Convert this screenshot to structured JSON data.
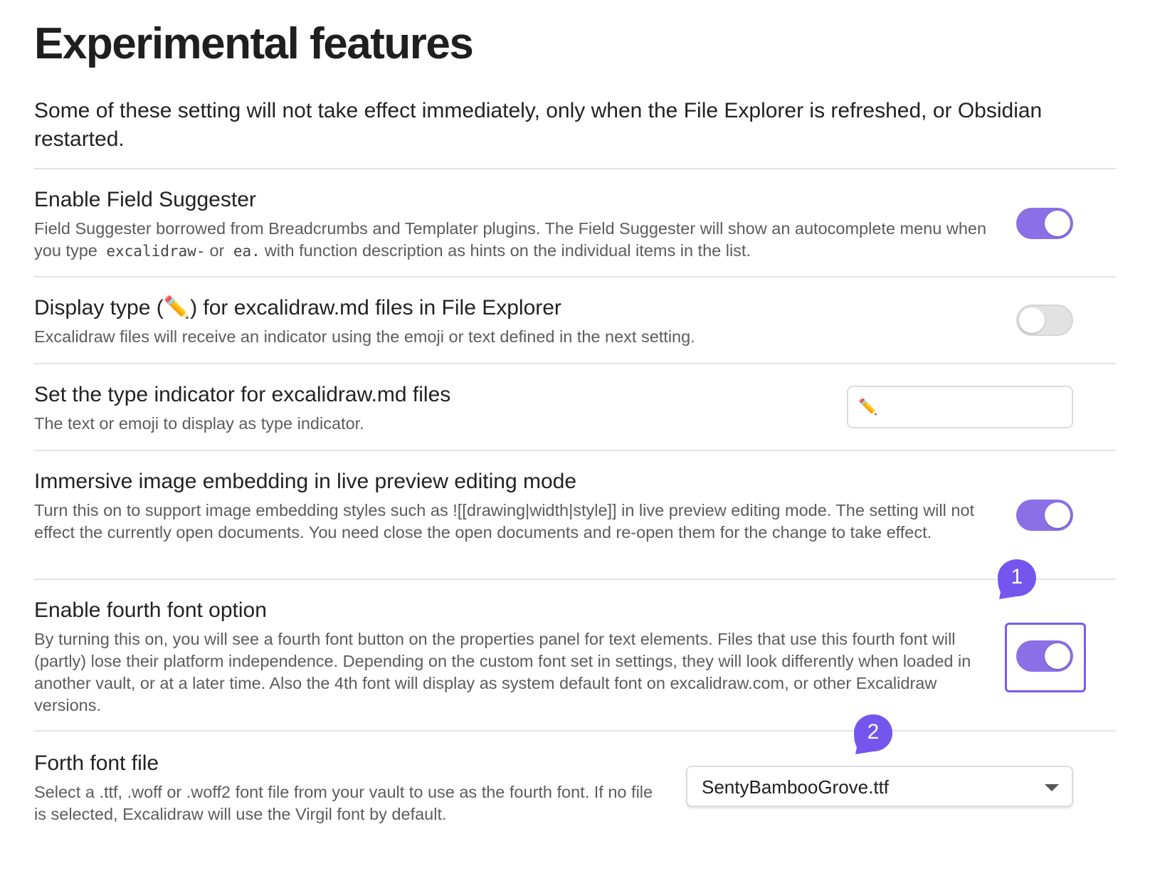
{
  "page": {
    "title": "Experimental features",
    "intro": "Some of these setting will not take effect immediately, only when the File Explorer is refreshed, or Obsidian restarted."
  },
  "settings": [
    {
      "name": "Enable Field Suggester",
      "desc_before": "Field Suggester borrowed from Breadcrumbs and Templater plugins. The Field Suggester will show an autocomplete menu when you type",
      "code1": "excalidraw-",
      "desc_mid": "or",
      "code2": "ea.",
      "desc_after": "with function description as hints on the individual items in the list.",
      "control": "toggle",
      "enabled": true
    },
    {
      "name": "Display type (✏️) for excalidraw.md files in File Explorer",
      "desc": "Excalidraw files will receive an indicator using the emoji or text defined in the next setting.",
      "control": "toggle",
      "enabled": false
    },
    {
      "name": "Set the type indicator for excalidraw.md files",
      "desc": "The text or emoji to display as type indicator.",
      "control": "text",
      "value": "✏️"
    },
    {
      "name": "Immersive image embedding in live preview editing mode",
      "desc": "Turn this on to support image embedding styles such as ![[drawing|width|style]] in live preview editing mode. The setting will not effect the currently open documents. You need close the open documents and re-open them for the change to take effect.",
      "control": "toggle",
      "enabled": true
    },
    {
      "name": "Enable fourth font option",
      "desc": "By turning this on, you will see a fourth font button on the properties panel for text elements. Files that use this fourth font will (partly) lose their platform independence. Depending on the custom font set in settings, they will look differently when loaded in another vault, or at a later time. Also the 4th font will display as system default font on excalidraw.com, or other Excalidraw versions.",
      "control": "toggle",
      "enabled": true
    },
    {
      "name": "Forth font file",
      "desc": "Select a .ttf, .woff or .woff2 font file from your vault to use as the fourth font. If no file is selected, Excalidraw will use the Virgil font by default.",
      "control": "select",
      "value": "SentyBambooGrove.ttf"
    }
  ],
  "callouts": [
    {
      "label": "1"
    },
    {
      "label": "2"
    }
  ],
  "colors": {
    "accent": "#8b6fe6",
    "callout": "#7456ee",
    "highlight": "#7a5af0"
  }
}
